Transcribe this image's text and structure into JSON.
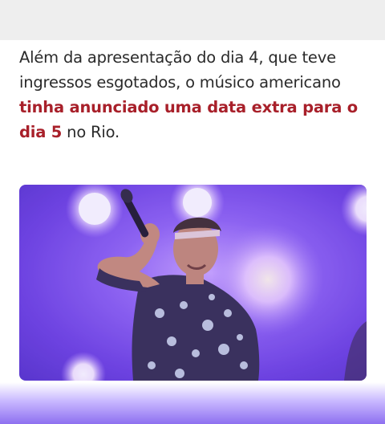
{
  "article": {
    "line1": "Além da apresentação do dia 4, que teve",
    "line2": "ingressos esgotados, o músico americano",
    "highlight_line3": "tinha anunciado uma data extra para o",
    "highlight_line4": "dia 5",
    "tail_line4": " no Rio."
  },
  "colors": {
    "highlight": "#a8202a",
    "text": "#2a2a2a",
    "stage_purple": "#6a3fe0"
  },
  "photo": {
    "icons": [
      "microphone-icon"
    ]
  }
}
